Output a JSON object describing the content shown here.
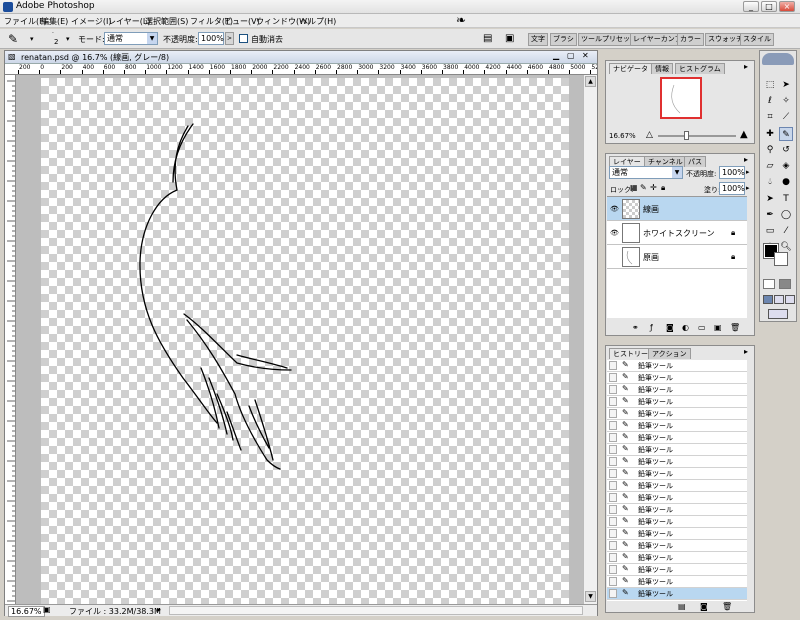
{
  "window": {
    "title": "Adobe Photoshop",
    "controls": [
      "_",
      "□",
      "×"
    ]
  },
  "menu": [
    "ファイル(F)",
    "編集(E)",
    "イメージ(I)",
    "レイヤー(L)",
    "選択範囲(S)",
    "フィルタ(T)",
    "ビュー(V)",
    "ウィンドウ(W)",
    "ヘルプ(H)"
  ],
  "options": {
    "brush_size": "2",
    "mode_label": "モード:",
    "mode_value": "通常",
    "opacity_label": "不透明度:",
    "opacity_value": "100%",
    "auto_erase_label": "自動消去"
  },
  "palette_well_tabs": [
    "文字",
    "ブラシ",
    "ツールプリセット",
    "レイヤーカンプ",
    "カラー",
    "スウォッチ",
    "スタイル"
  ],
  "document": {
    "title": "renatan.psd @ 16.7% (線画, グレー/8)",
    "ruler_h": [
      "200",
      "0",
      "200",
      "400",
      "600",
      "800",
      "1000",
      "1200",
      "1400",
      "1600",
      "1800",
      "2000",
      "2200",
      "2400",
      "2600",
      "2800",
      "3000",
      "3200",
      "3400",
      "3600",
      "3800",
      "4000",
      "4200",
      "4400",
      "4600",
      "4800",
      "5000",
      "520"
    ],
    "zoom": "16.67%",
    "file_info": "ファイル : 33.2M/38.3M"
  },
  "navigator": {
    "tabs": [
      "ナビゲータ",
      "情報",
      "ヒストグラム"
    ],
    "zoom": "16.67%"
  },
  "layers": {
    "tabs": [
      "レイヤー",
      "チャンネル",
      "パス"
    ],
    "blend_mode": "通常",
    "opacity_label": "不透明度:",
    "opacity_value": "100%",
    "lock_label": "ロック:",
    "fill_label": "塗り:",
    "fill_value": "100%",
    "items": [
      {
        "name": "線画",
        "visible": true,
        "selected": true,
        "locked": false
      },
      {
        "name": "ホワイトスクリーン",
        "visible": true,
        "selected": false,
        "locked": true
      },
      {
        "name": "原画",
        "visible": false,
        "selected": false,
        "locked": true
      }
    ]
  },
  "history": {
    "tabs": [
      "ヒストリー",
      "アクション"
    ],
    "items": [
      "鉛筆ツール",
      "鉛筆ツール",
      "鉛筆ツール",
      "鉛筆ツール",
      "鉛筆ツール",
      "鉛筆ツール",
      "鉛筆ツール",
      "鉛筆ツール",
      "鉛筆ツール",
      "鉛筆ツール",
      "鉛筆ツール",
      "鉛筆ツール",
      "鉛筆ツール",
      "鉛筆ツール",
      "鉛筆ツール",
      "鉛筆ツール",
      "鉛筆ツール",
      "鉛筆ツール",
      "鉛筆ツール",
      "鉛筆ツール"
    ]
  },
  "colors": {
    "accent_select": "#b9d7f0",
    "foreground": "#000000",
    "background": "#ffffff",
    "nav_frame": "#e03030"
  }
}
